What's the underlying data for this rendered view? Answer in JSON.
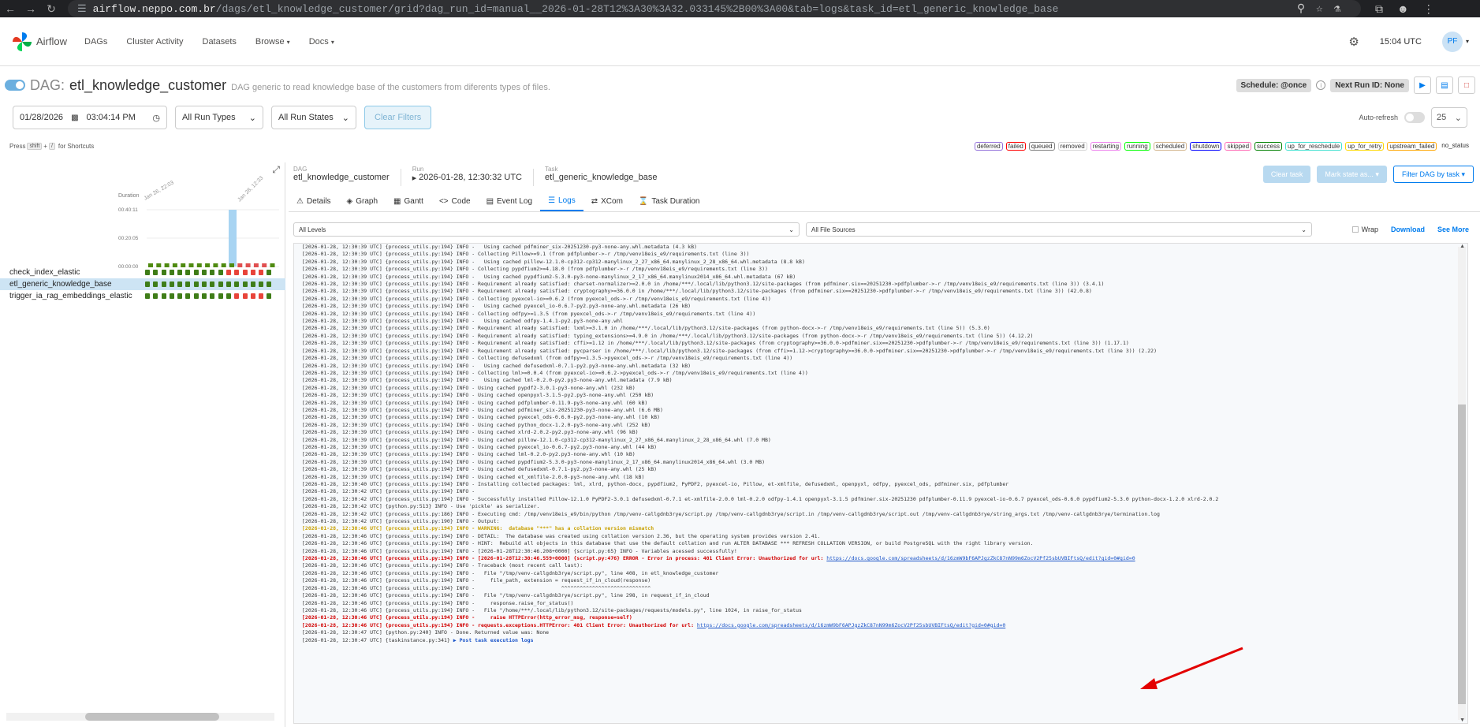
{
  "browser": {
    "url_host": "airflow.neppo.com.br",
    "url_path": "/dags/etl_knowledge_customer/grid?dag_run_id=manual__2026-01-28T12%3A30%3A32.033145%2B00%3A00&tab=logs&task_id=etl_generic_knowledge_base"
  },
  "nav": {
    "brand": "Airflow",
    "items": [
      "DAGs",
      "Cluster Activity",
      "Datasets",
      "Browse",
      "Docs"
    ],
    "time": "15:04 UTC",
    "user_initials": "PF"
  },
  "dag": {
    "prefix": "DAG:",
    "name": "etl_knowledge_customer",
    "description": "DAG generic to read knowledge base of the customers from diferents types of files.",
    "schedule": "Schedule: @once",
    "next_run": "Next Run ID: None"
  },
  "filters": {
    "date": "01/28/2026",
    "time": "03:04:14 PM",
    "run_types": "All Run Types",
    "run_states": "All Run States",
    "clear": "Clear Filters",
    "autorefresh": "Auto-refresh",
    "limit": "25"
  },
  "shortcuts": {
    "press": "Press",
    "key1": "shift",
    "plus": "+",
    "key2": "/",
    "suffix": "for Shortcuts"
  },
  "legend": [
    {
      "label": "deferred",
      "color": "#9370db"
    },
    {
      "label": "failed",
      "color": "#ff0000"
    },
    {
      "label": "queued",
      "color": "#808080"
    },
    {
      "label": "removed",
      "color": "#d3d3d3"
    },
    {
      "label": "restarting",
      "color": "#ee82ee"
    },
    {
      "label": "running",
      "color": "#00ff00"
    },
    {
      "label": "scheduled",
      "color": "#d2b48c"
    },
    {
      "label": "shutdown",
      "color": "#0000ff"
    },
    {
      "label": "skipped",
      "color": "#ff69b4"
    },
    {
      "label": "success",
      "color": "#008000"
    },
    {
      "label": "up_for_reschedule",
      "color": "#40e0d0"
    },
    {
      "label": "up_for_retry",
      "color": "#ffd700"
    },
    {
      "label": "upstream_failed",
      "color": "#ffa500"
    },
    {
      "label": "no_status",
      "color": "#ffffff"
    }
  ],
  "grid": {
    "duration_label": "Duration",
    "ticks": [
      "00:40:11",
      "00:20:05",
      "00:00:00"
    ],
    "date_labels": [
      "Jan 26, 22:03",
      "Jan 28, 12:33"
    ],
    "tasks": [
      {
        "name": "check_index_elastic",
        "states": [
          "s",
          "s",
          "s",
          "s",
          "s",
          "s",
          "s",
          "s",
          "s",
          "s",
          "f",
          "f",
          "f",
          "f",
          "f",
          "s"
        ]
      },
      {
        "name": "etl_generic_knowledge_base",
        "states": [
          "s",
          "s",
          "s",
          "s",
          "s",
          "s",
          "s",
          "s",
          "s",
          "s",
          "s",
          "s",
          "s",
          "s",
          "s",
          "s"
        ]
      },
      {
        "name": "trigger_ia_rag_embeddings_elastic",
        "states": [
          "s",
          "s",
          "s",
          "s",
          "s",
          "s",
          "s",
          "s",
          "s",
          "s",
          "s",
          "f",
          "f",
          "f",
          "f",
          "s"
        ]
      }
    ]
  },
  "breadcrumb": {
    "dag_label": "DAG",
    "dag_value": "etl_knowledge_customer",
    "run_label": "Run",
    "run_value": "2026-01-28, 12:30:32 UTC",
    "task_label": "Task",
    "task_value": "etl_generic_knowledge_base"
  },
  "actions": {
    "clear_task": "Clear task",
    "mark_state": "Mark state as...",
    "filter_dag": "Filter DAG by task"
  },
  "tabs": [
    "Details",
    "Graph",
    "Gantt",
    "Code",
    "Event Log",
    "Logs",
    "XCom",
    "Task Duration"
  ],
  "log_controls": {
    "levels": "All Levels",
    "sources": "All File Sources",
    "wrap": "Wrap",
    "download": "Download",
    "see_more": "See More"
  },
  "log_lines": [
    {
      "t": "[2026-01-28, 12:30:39 UTC] {process_utils.py:194} INFO -   Using cached pdfminer_six-20251230-py3-none-any.whl.metadata (4.3 kB)"
    },
    {
      "t": "[2026-01-28, 12:30:39 UTC] {process_utils.py:194} INFO - Collecting Pillow>=9.1 (from pdfplumber->-r /tmp/venv18eis_e9/requirements.txt (line 3))"
    },
    {
      "t": "[2026-01-28, 12:30:39 UTC] {process_utils.py:194} INFO -   Using cached pillow-12.1.0-cp312-cp312-manylinux_2_27_x86_64.manylinux_2_28_x86_64.whl.metadata (8.8 kB)"
    },
    {
      "t": "[2026-01-28, 12:30:39 UTC] {process_utils.py:194} INFO - Collecting pypdfium2>=4.18.0 (from pdfplumber->-r /tmp/venv18eis_e9/requirements.txt (line 3))"
    },
    {
      "t": "[2026-01-28, 12:30:39 UTC] {process_utils.py:194} INFO -   Using cached pypdfium2-5.3.0-py3-none-manylinux_2_17_x86_64.manylinux2014_x86_64.whl.metadata (67 kB)"
    },
    {
      "t": "[2026-01-28, 12:30:39 UTC] {process_utils.py:194} INFO - Requirement already satisfied: charset-normalizer>=2.0.0 in /home/***/.local/lib/python3.12/site-packages (from pdfminer.six==20251230->pdfplumber->-r /tmp/venv18eis_e9/requirements.txt (line 3)) (3.4.1)"
    },
    {
      "t": "[2026-01-28, 12:30:39 UTC] {process_utils.py:194} INFO - Requirement already satisfied: cryptography>=36.0.0 in /home/***/.local/lib/python3.12/site-packages (from pdfminer.six==20251230->pdfplumber->-r /tmp/venv18eis_e9/requirements.txt (line 3)) (42.0.8)"
    },
    {
      "t": "[2026-01-28, 12:30:39 UTC] {process_utils.py:194} INFO - Collecting pyexcel-io>=0.6.2 (from pyexcel_ods->-r /tmp/venv18eis_e9/requirements.txt (line 4))"
    },
    {
      "t": "[2026-01-28, 12:30:39 UTC] {process_utils.py:194} INFO -   Using cached pyexcel_io-0.6.7-py2.py3-none-any.whl.metadata (26 kB)"
    },
    {
      "t": "[2026-01-28, 12:30:39 UTC] {process_utils.py:194} INFO - Collecting odfpy>=1.3.5 (from pyexcel_ods->-r /tmp/venv18eis_e9/requirements.txt (line 4))"
    },
    {
      "t": "[2026-01-28, 12:30:39 UTC] {process_utils.py:194} INFO -   Using cached odfpy-1.4.1-py2.py3-none-any.whl"
    },
    {
      "t": "[2026-01-28, 12:30:39 UTC] {process_utils.py:194} INFO - Requirement already satisfied: lxml>=3.1.0 in /home/***/.local/lib/python3.12/site-packages (from python-docx->-r /tmp/venv18eis_e9/requirements.txt (line 5)) (5.3.0)"
    },
    {
      "t": "[2026-01-28, 12:30:39 UTC] {process_utils.py:194} INFO - Requirement already satisfied: typing_extensions>=4.9.0 in /home/***/.local/lib/python3.12/site-packages (from python-docx->-r /tmp/venv18eis_e9/requirements.txt (line 5)) (4.12.2)"
    },
    {
      "t": "[2026-01-28, 12:30:39 UTC] {process_utils.py:194} INFO - Requirement already satisfied: cffi>=1.12 in /home/***/.local/lib/python3.12/site-packages (from cryptography>=36.0.0->pdfminer.six==20251230->pdfplumber->-r /tmp/venv18eis_e9/requirements.txt (line 3)) (1.17.1)"
    },
    {
      "t": "[2026-01-28, 12:30:39 UTC] {process_utils.py:194} INFO - Requirement already satisfied: pycparser in /home/***/.local/lib/python3.12/site-packages (from cffi>=1.12->cryptography>=36.0.0->pdfminer.six==20251230->pdfplumber->-r /tmp/venv18eis_e9/requirements.txt (line 3)) (2.22)"
    },
    {
      "t": "[2026-01-28, 12:30:39 UTC] {process_utils.py:194} INFO - Collecting defusedxml (from odfpy>=1.3.5->pyexcel_ods->-r /tmp/venv18eis_e9/requirements.txt (line 4))"
    },
    {
      "t": "[2026-01-28, 12:30:39 UTC] {process_utils.py:194} INFO -   Using cached defusedxml-0.7.1-py2.py3-none-any.whl.metadata (32 kB)"
    },
    {
      "t": "[2026-01-28, 12:30:39 UTC] {process_utils.py:194} INFO - Collecting lml>=0.0.4 (from pyexcel-io>=0.6.2->pyexcel_ods->-r /tmp/venv18eis_e9/requirements.txt (line 4))"
    },
    {
      "t": "[2026-01-28, 12:30:39 UTC] {process_utils.py:194} INFO -   Using cached lml-0.2.0-py2.py3-none-any.whl.metadata (7.9 kB)"
    },
    {
      "t": "[2026-01-28, 12:30:39 UTC] {process_utils.py:194} INFO - Using cached pypdf2-3.0.1-py3-none-any.whl (232 kB)"
    },
    {
      "t": "[2026-01-28, 12:30:39 UTC] {process_utils.py:194} INFO - Using cached openpyxl-3.1.5-py2.py3-none-any.whl (250 kB)"
    },
    {
      "t": "[2026-01-28, 12:30:39 UTC] {process_utils.py:194} INFO - Using cached pdfplumber-0.11.9-py3-none-any.whl (60 kB)"
    },
    {
      "t": "[2026-01-28, 12:30:39 UTC] {process_utils.py:194} INFO - Using cached pdfminer_six-20251230-py3-none-any.whl (6.6 MB)"
    },
    {
      "t": "[2026-01-28, 12:30:39 UTC] {process_utils.py:194} INFO - Using cached pyexcel_ods-0.6.0-py2.py3-none-any.whl (10 kB)"
    },
    {
      "t": "[2026-01-28, 12:30:39 UTC] {process_utils.py:194} INFO - Using cached python_docx-1.2.0-py3-none-any.whl (252 kB)"
    },
    {
      "t": "[2026-01-28, 12:30:39 UTC] {process_utils.py:194} INFO - Using cached xlrd-2.0.2-py2.py3-none-any.whl (96 kB)"
    },
    {
      "t": "[2026-01-28, 12:30:39 UTC] {process_utils.py:194} INFO - Using cached pillow-12.1.0-cp312-cp312-manylinux_2_27_x86_64.manylinux_2_28_x86_64.whl (7.0 MB)"
    },
    {
      "t": "[2026-01-28, 12:30:39 UTC] {process_utils.py:194} INFO - Using cached pyexcel_io-0.6.7-py2.py3-none-any.whl (44 kB)"
    },
    {
      "t": "[2026-01-28, 12:30:39 UTC] {process_utils.py:194} INFO - Using cached lml-0.2.0-py2.py3-none-any.whl (10 kB)"
    },
    {
      "t": "[2026-01-28, 12:30:39 UTC] {process_utils.py:194} INFO - Using cached pypdfium2-5.3.0-py3-none-manylinux_2_17_x86_64.manylinux2014_x86_64.whl (3.0 MB)"
    },
    {
      "t": "[2026-01-28, 12:30:39 UTC] {process_utils.py:194} INFO - Using cached defusedxml-0.7.1-py2.py3-none-any.whl (25 kB)"
    },
    {
      "t": "[2026-01-28, 12:30:39 UTC] {process_utils.py:194} INFO - Using cached et_xmlfile-2.0.0-py3-none-any.whl (18 kB)"
    },
    {
      "t": "[2026-01-28, 12:30:40 UTC] {process_utils.py:194} INFO - Installing collected packages: lml, xlrd, python-docx, pypdfium2, PyPDF2, pyexcel-io, Pillow, et-xmlfile, defusedxml, openpyxl, odfpy, pyexcel_ods, pdfminer.six, pdfplumber"
    },
    {
      "t": "[2026-01-28, 12:30:42 UTC] {process_utils.py:194} INFO -"
    },
    {
      "t": "[2026-01-28, 12:30:42 UTC] {process_utils.py:194} INFO - Successfully installed Pillow-12.1.0 PyPDF2-3.0.1 defusedxml-0.7.1 et-xmlfile-2.0.0 lml-0.2.0 odfpy-1.4.1 openpyxl-3.1.5 pdfminer.six-20251230 pdfplumber-0.11.9 pyexcel-io-0.6.7 pyexcel_ods-0.6.0 pypdfium2-5.3.0 python-docx-1.2.0 xlrd-2.0.2"
    },
    {
      "t": "[2026-01-28, 12:30:42 UTC] {python.py:513} INFO - Use 'pickle' as serializer."
    },
    {
      "t": "[2026-01-28, 12:30:42 UTC] {process_utils.py:186} INFO - Executing cmd: /tmp/venv18eis_e9/bin/python /tmp/venv-callgdnb3rye/script.py /tmp/venv-callgdnb3rye/script.in /tmp/venv-callgdnb3rye/script.out /tmp/venv-callgdnb3rye/string_args.txt /tmp/venv-callgdnb3rye/termination.log"
    },
    {
      "t": "[2026-01-28, 12:30:42 UTC] {process_utils.py:190} INFO - Output:"
    },
    {
      "t": "[2026-01-28, 12:30:46 UTC] {process_utils.py:194} INFO - WARNING:  database \"***\" has a collation version mismatch",
      "k": "warn"
    },
    {
      "t": "[2026-01-28, 12:30:46 UTC] {process_utils.py:194} INFO - DETAIL:  The database was created using collation version 2.36, but the operating system provides version 2.41."
    },
    {
      "t": "[2026-01-28, 12:30:46 UTC] {process_utils.py:194} INFO - HINT:  Rebuild all objects in this database that use the default collation and run ALTER DATABASE *** REFRESH COLLATION VERSION, or build PostgreSQL with the right library version."
    },
    {
      "t": "[2026-01-28, 12:30:46 UTC] {process_utils.py:194} INFO - [2026-01-28T12:30:46.208+0000] {script.py:65} INFO - Variables acessed successfully!"
    },
    {
      "t": "[2026-01-28, 12:30:46 UTC] {process_utils.py:194} INFO - [2026-01-28T12:30:46.559+0000] {script.py:476} ERROR - Error in process: 401 Client Error: Unauthorized for url: ",
      "k": "err",
      "u": "https://docs.google.com/spreadsheets/d/16zmW9bF6APJgzZkC87nN99m6ZocV2Pf25sbUVBIFtsQ/edit?gid=0#gid=0"
    },
    {
      "t": "[2026-01-28, 12:30:46 UTC] {process_utils.py:194} INFO - Traceback (most recent call last):"
    },
    {
      "t": "[2026-01-28, 12:30:46 UTC] {process_utils.py:194} INFO -   File \"/tmp/venv-callgdnb3rye/script.py\", line 408, in etl_knowledge_customer"
    },
    {
      "t": "[2026-01-28, 12:30:46 UTC] {process_utils.py:194} INFO -     file_path, extension = request_if_in_cloud(response)"
    },
    {
      "t": "[2026-01-28, 12:30:46 UTC] {process_utils.py:194} INFO -                            ^^^^^^^^^^^^^^^^^^^^^^^^^^^^^"
    },
    {
      "t": "[2026-01-28, 12:30:46 UTC] {process_utils.py:194} INFO -   File \"/tmp/venv-callgdnb3rye/script.py\", line 298, in request_if_in_cloud"
    },
    {
      "t": "[2026-01-28, 12:30:46 UTC] {process_utils.py:194} INFO -     response.raise_for_status()"
    },
    {
      "t": "[2026-01-28, 12:30:46 UTC] {process_utils.py:194} INFO -   File \"/home/***/.local/lib/python3.12/site-packages/requests/models.py\", line 1024, in raise_for_status"
    },
    {
      "t": "[2026-01-28, 12:30:46 UTC] {process_utils.py:194} INFO -     raise HTTPError(http_error_msg, response=self)",
      "k": "err"
    },
    {
      "t": "[2026-01-28, 12:30:46 UTC] {process_utils.py:194} INFO - requests.exceptions.HTTPError: 401 Client Error: Unauthorized for url: ",
      "k": "err",
      "u": "https://docs.google.com/spreadsheets/d/16zmW9bF6APJgzZkC87nN99m6ZocV2Pf25sbUVBIFtsQ/edit?gid=0#gid=0"
    },
    {
      "t": "[2026-01-28, 12:30:47 UTC] {python.py:240} INFO - Done. Returned value was: None"
    },
    {
      "t": "[2026-01-28, 12:30:47 UTC] {taskinstance.py:341} ",
      "tail": "▶ Post task execution logs"
    }
  ]
}
